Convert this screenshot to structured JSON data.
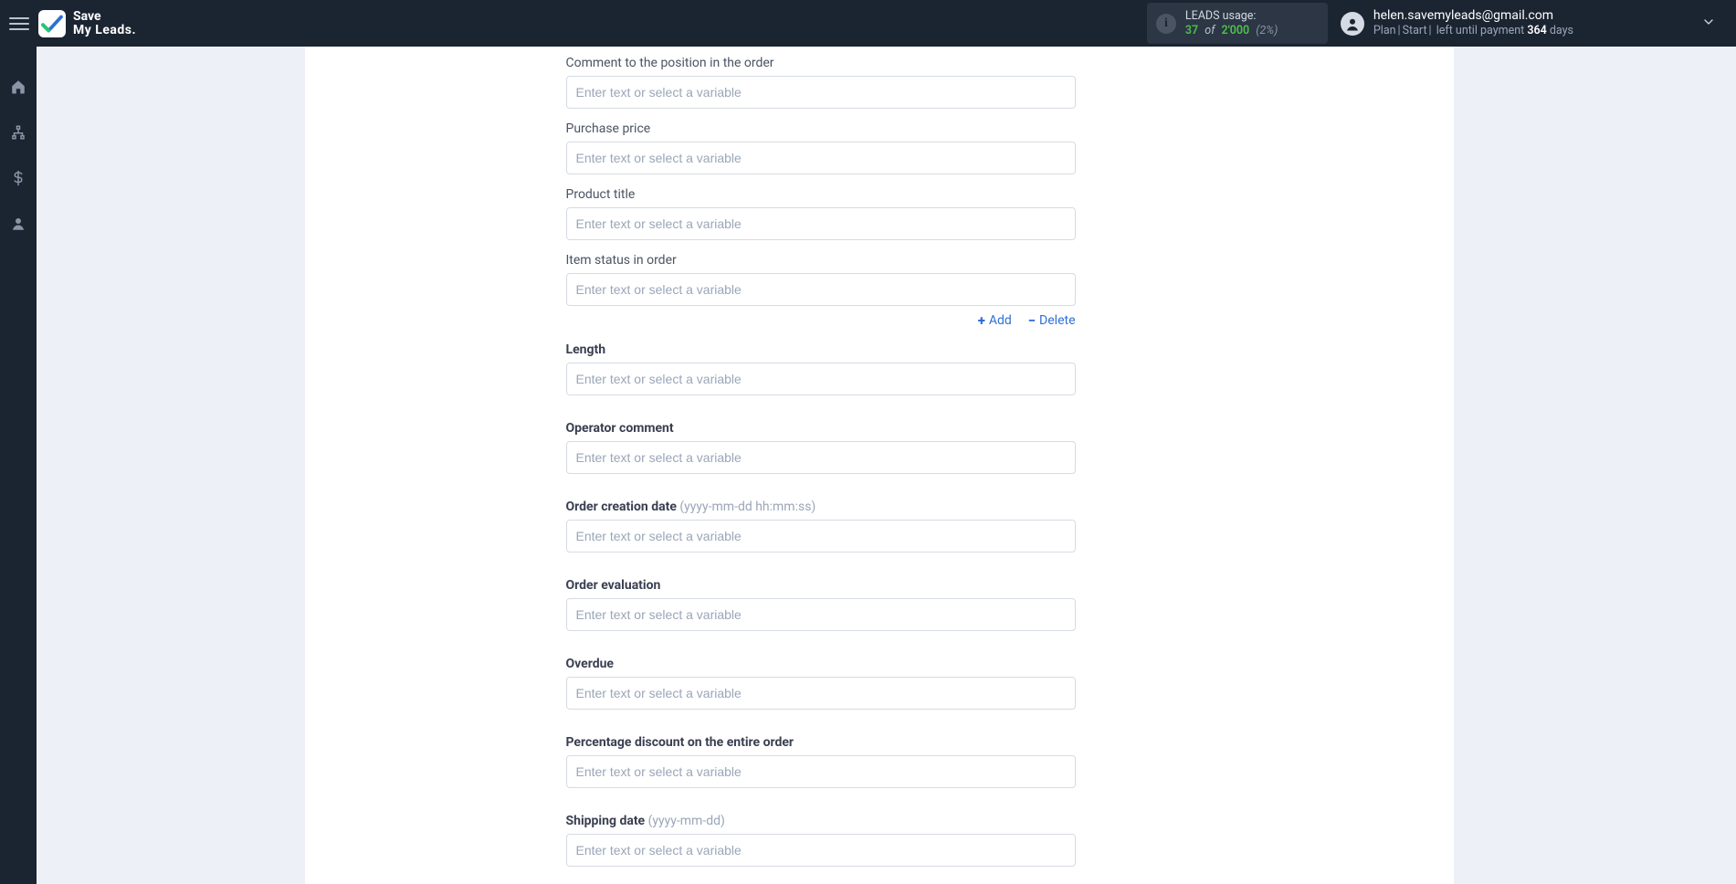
{
  "header": {
    "brand_line1": "Save",
    "brand_line2": "My Leads.",
    "leads": {
      "title": "LEADS usage:",
      "used": "37",
      "of_word": "of",
      "total": "2'000",
      "pct": "(2%)"
    },
    "user": {
      "email": "helen.savemyleads@gmail.com",
      "plan_word": "Plan",
      "plan_name": "Start",
      "left_label": "left until payment",
      "days_num": "364",
      "days_word": "days"
    }
  },
  "actions": {
    "add": "Add",
    "delete": "Delete"
  },
  "placeholder": "Enter text or select a variable",
  "fields": {
    "comment_position": {
      "label": "Comment to the position in the order"
    },
    "purchase_price": {
      "label": "Purchase price"
    },
    "product_title": {
      "label": "Product title"
    },
    "item_status": {
      "label": "Item status in order"
    },
    "length": {
      "label": "Length"
    },
    "operator_comment": {
      "label": "Operator comment"
    },
    "order_creation_date": {
      "label": "Order creation date",
      "hint": "(yyyy-mm-dd hh:mm:ss)"
    },
    "order_evaluation": {
      "label": "Order evaluation"
    },
    "overdue": {
      "label": "Overdue"
    },
    "pct_discount": {
      "label": "Percentage discount on the entire order"
    },
    "shipping_date": {
      "label": "Shipping date",
      "hint": "(yyyy-mm-dd)"
    }
  }
}
